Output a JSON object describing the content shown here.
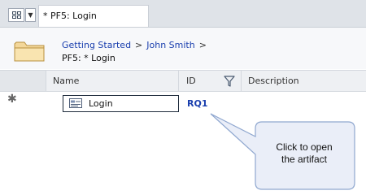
{
  "tabbar": {
    "layout_button_icon": "grid-icon",
    "dropdown_icon": "caret-down-icon",
    "active_tab": "* PF5: Login"
  },
  "breadcrumb": {
    "folder_icon": "folder-icon",
    "items": [
      "Getting Started",
      "John Smith"
    ],
    "separator": ">",
    "current": "PF5: * Login"
  },
  "columns": {
    "name": "Name",
    "id": "ID",
    "filter_icon": "filter-icon",
    "description": "Description"
  },
  "row": {
    "marker": "✱",
    "icon": "artifact-form-icon",
    "name": "Login",
    "id": "RQ1",
    "description": ""
  },
  "callout": {
    "text_line1": "Click to open",
    "text_line2": "the artifact",
    "fill": "#eaeef8",
    "stroke": "#8fa7cf"
  },
  "colors": {
    "link": "#1a3fae",
    "tabbar_bg": "#dfe3e8",
    "header_bg": "#eef0f3"
  }
}
